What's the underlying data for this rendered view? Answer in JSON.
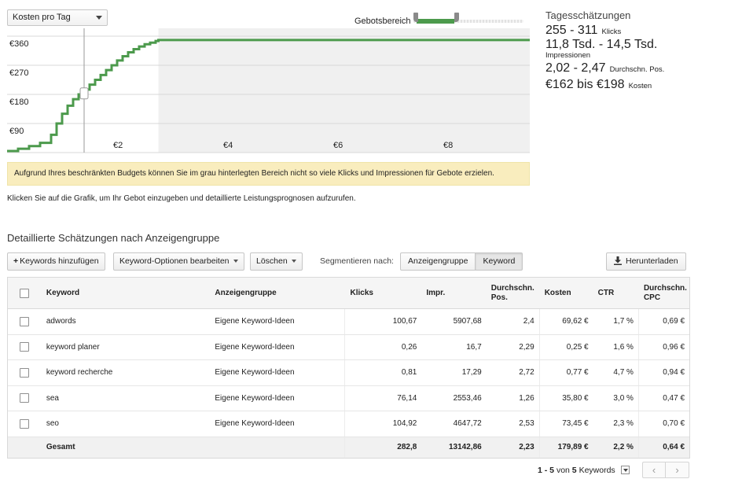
{
  "chart_controls": {
    "metric_select": "Kosten pro Tag",
    "bid_range_label": "Gebotsbereich",
    "bid_range": {
      "low_fraction": 0.03,
      "high_fraction": 0.37
    }
  },
  "chart_data": {
    "type": "line",
    "x_label": "",
    "y_label": "",
    "x_ticks": [
      "€2",
      "€4",
      "€6",
      "€8"
    ],
    "y_ticks": [
      "€360",
      "€270",
      "€180",
      "€90"
    ],
    "xlim": [
      0,
      9.5
    ],
    "ylim": [
      0,
      360
    ],
    "series": [
      {
        "x": [
          0,
          0.2,
          0.4,
          0.6,
          0.8,
          0.9,
          1.0,
          1.1,
          1.2,
          1.3,
          1.4,
          1.5,
          1.6,
          1.7,
          1.8,
          1.9,
          2.0,
          2.1,
          2.2,
          2.3,
          2.4,
          2.5,
          2.6,
          2.7,
          2.75,
          9.5
        ],
        "y": [
          5,
          12,
          20,
          30,
          55,
          90,
          120,
          145,
          165,
          180,
          195,
          210,
          225,
          240,
          255,
          270,
          285,
          298,
          310,
          320,
          328,
          335,
          340,
          345,
          348,
          348
        ]
      }
    ],
    "bid_marker": {
      "x": 1.4,
      "y": 183
    },
    "grey_region_start_x": 2.75,
    "colors": {
      "line": "#4c9a4c",
      "grey_region": "#f0f0f0",
      "grid": "#d8d8d8"
    }
  },
  "estimates": {
    "title": "Tagesschätzungen",
    "clicks_value": "255 - 311",
    "clicks_label": "Klicks",
    "impr_value": "11,8 Tsd. - 14,5 Tsd.",
    "impr_label": "Impressionen",
    "pos_value": "2,02 - 2,47",
    "pos_label": "Durchschn. Pos.",
    "cost_value": "€162 bis €198",
    "cost_label": "Kosten"
  },
  "warning_text": "Aufgrund Ihres beschränkten Budgets können Sie im grau hinterlegten Bereich nicht so viele Klicks und Impressionen für Gebote erzielen.",
  "hint_text": "Klicken Sie auf die Grafik, um Ihr Gebot einzugeben und detaillierte Leistungsprognosen aufzurufen.",
  "section_title": "Detaillierte Schätzungen nach Anzeigengruppe",
  "toolbar": {
    "add_keywords": "Keywords hinzufügen",
    "edit_options": "Keyword-Optionen bearbeiten",
    "delete": "Löschen",
    "segment_label": "Segmentieren nach:",
    "segment_adgroup": "Anzeigengruppe",
    "segment_keyword": "Keyword",
    "download": "Herunterladen"
  },
  "table": {
    "headers": {
      "keyword": "Keyword",
      "adgroup": "Anzeigengruppe",
      "clicks": "Klicks",
      "impr": "Impr.",
      "pos_1": "Durchschn.",
      "pos_2": "Pos.",
      "cost": "Kosten",
      "ctr": "CTR",
      "cpc_1": "Durchschn.",
      "cpc_2": "CPC"
    },
    "rows": [
      {
        "keyword": "adwords",
        "adgroup": "Eigene Keyword-Ideen",
        "clicks": "100,67",
        "impr": "5907,68",
        "pos": "2,4",
        "cost": "69,62 €",
        "ctr": "1,7 %",
        "cpc": "0,69 €"
      },
      {
        "keyword": "keyword planer",
        "adgroup": "Eigene Keyword-Ideen",
        "clicks": "0,26",
        "impr": "16,7",
        "pos": "2,29",
        "cost": "0,25 €",
        "ctr": "1,6 %",
        "cpc": "0,96 €"
      },
      {
        "keyword": "keyword recherche",
        "adgroup": "Eigene Keyword-Ideen",
        "clicks": "0,81",
        "impr": "17,29",
        "pos": "2,72",
        "cost": "0,77 €",
        "ctr": "4,7 %",
        "cpc": "0,94 €"
      },
      {
        "keyword": "sea",
        "adgroup": "Eigene Keyword-Ideen",
        "clicks": "76,14",
        "impr": "2553,46",
        "pos": "1,26",
        "cost": "35,80 €",
        "ctr": "3,0 %",
        "cpc": "0,47 €"
      },
      {
        "keyword": "seo",
        "adgroup": "Eigene Keyword-Ideen",
        "clicks": "104,92",
        "impr": "4647,72",
        "pos": "2,53",
        "cost": "73,45 €",
        "ctr": "2,3 %",
        "cpc": "0,70 €"
      }
    ],
    "total": {
      "label": "Gesamt",
      "clicks": "282,8",
      "impr": "13142,86",
      "pos": "2,23",
      "cost": "179,89 €",
      "ctr": "2,2 %",
      "cpc": "0,64 €"
    }
  },
  "pagination": {
    "range": "1 - 5",
    "of_label": "von",
    "total": "5",
    "unit": "Keywords",
    "prev_icon": "chevron-left-icon",
    "next_icon": "chevron-right-icon"
  }
}
